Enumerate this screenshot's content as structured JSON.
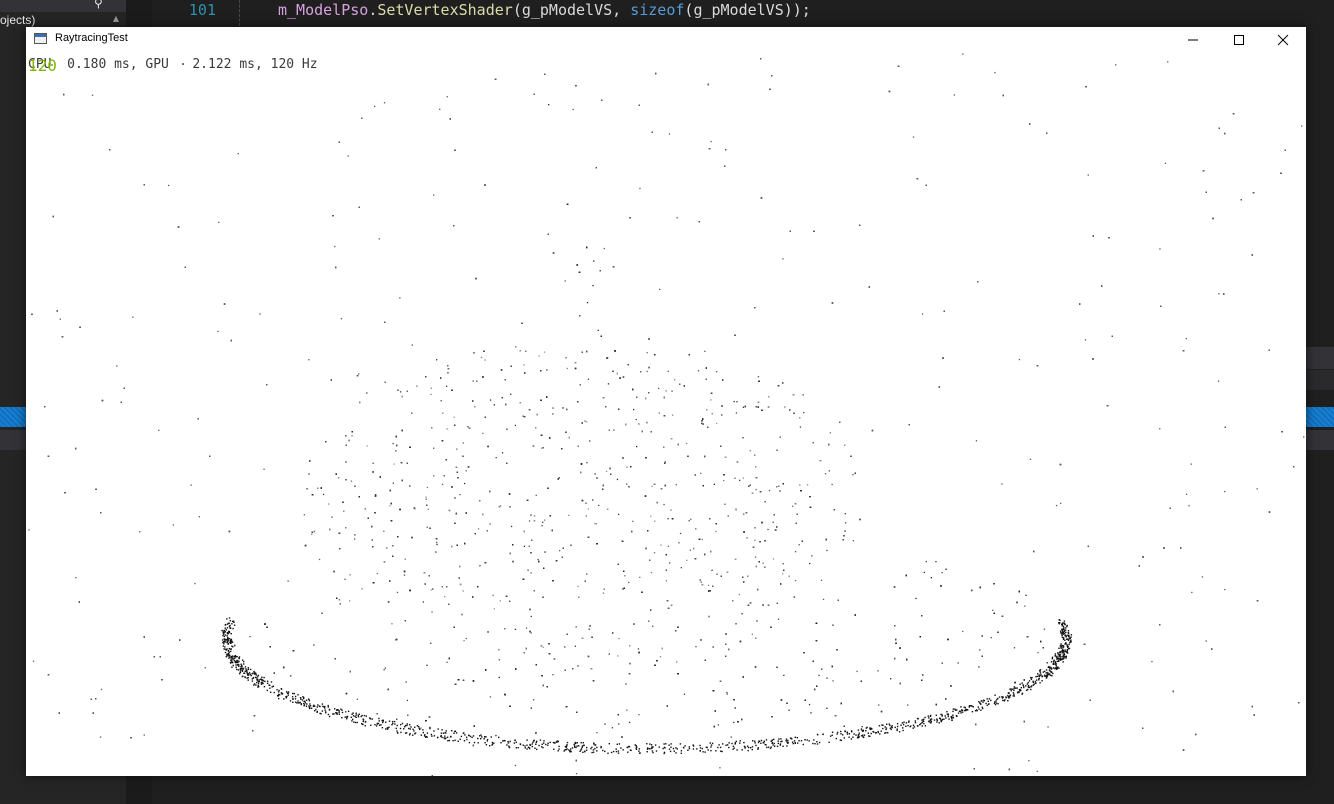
{
  "ide": {
    "left_panel_text": "ojects)",
    "line_number": "101",
    "code": {
      "object": "m_ModelPso",
      "dot": ".",
      "method": "SetVertexShader",
      "open": "(",
      "arg1": "g_pModelVS",
      "comma": ", ",
      "keyword": "sizeof",
      "open2": "(",
      "arg2": "g_pModelVS",
      "close": "));"
    }
  },
  "window": {
    "title": "RaytracingTest",
    "controls": {
      "minimize_icon": "minimize-icon",
      "maximize_icon": "maximize-icon",
      "close_icon": "close-icon"
    }
  },
  "overlay": {
    "fps": "120",
    "stats": "CPU  0.180 ms, GPU   2.122 ms, 120 Hz"
  },
  "colors": {
    "ide_bg": "#1f1f1f",
    "accent_blue": "#0e70c0",
    "fps_green": "#7fb800",
    "viewport_bg": "#ffffff"
  }
}
